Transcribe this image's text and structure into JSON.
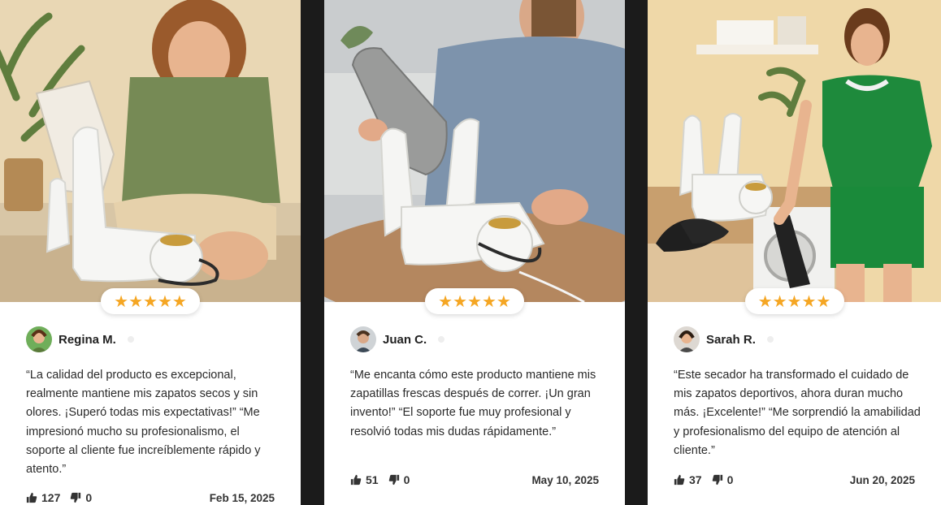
{
  "colors": {
    "star": "#f5a623",
    "background": "#1b1b1b",
    "card": "#ffffff",
    "text": "#2a2a2a"
  },
  "reviews": [
    {
      "name": "Regina M.",
      "rating": 5,
      "stars": "★★★★★",
      "text": "“La calidad del producto es excepcional, realmente mantiene mis zapatos secos y sin olores. ¡Superó todas mis expectativas!” “Me impresionó mucho su profesionalismo, el soporte al cliente fue increíblemente rápido y atento.”",
      "likes": "127",
      "dislikes": "0",
      "date": "Feb 15, 2025"
    },
    {
      "name": "Juan C.",
      "rating": 5,
      "stars": "★★★★★",
      "text": "“Me encanta cómo este producto mantiene mis zapatillas frescas después de correr. ¡Un gran invento!” “El soporte fue muy profesional y resolvió todas mis dudas rápidamente.”",
      "likes": "51",
      "dislikes": "0",
      "date": "May 10, 2025"
    },
    {
      "name": "Sarah R.",
      "rating": 5,
      "stars": "★★★★★",
      "text": "“Este secador ha transformado el cuidado de mis zapatos deportivos, ahora duran mucho más. ¡Excelente!” “Me sorprendió la amabilidad y profesionalismo del equipo de atención al cliente.”",
      "likes": "37",
      "dislikes": "0",
      "date": "Jun 20, 2025"
    }
  ]
}
